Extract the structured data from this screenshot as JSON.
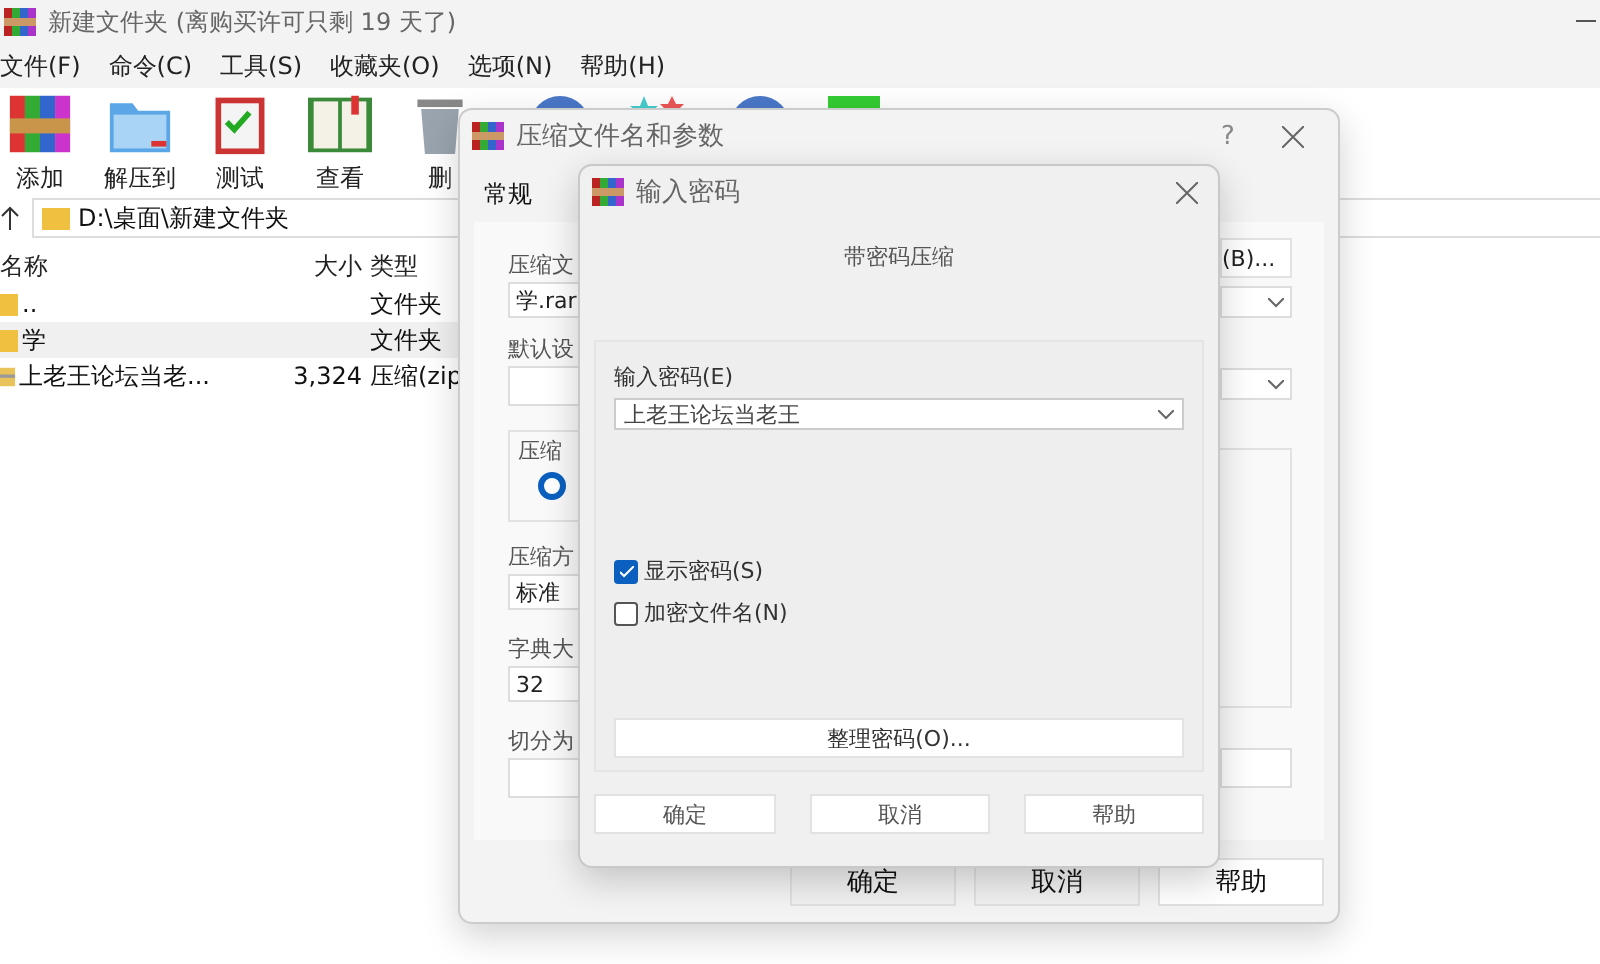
{
  "window": {
    "title": "新建文件夹 (离购买许可只剩 19 天了)"
  },
  "menu": [
    "文件(F)",
    "命令(C)",
    "工具(S)",
    "收藏夹(O)",
    "选项(N)",
    "帮助(H)"
  ],
  "toolbar": [
    {
      "kind": "add",
      "label": "添加"
    },
    {
      "kind": "extract",
      "label": "解压到"
    },
    {
      "kind": "test",
      "label": "测试"
    },
    {
      "kind": "view",
      "label": "查看"
    },
    {
      "kind": "delete",
      "label": "删"
    },
    {
      "kind": "globe"
    },
    {
      "kind": "wizard"
    },
    {
      "kind": "globe"
    },
    {
      "kind": "sfx"
    }
  ],
  "address": {
    "path": "D:\\桌面\\新建文件夹"
  },
  "file_list": {
    "columns": [
      "名称",
      "大小",
      "类型"
    ],
    "rows": [
      {
        "name": "..",
        "type": "文件夹",
        "kind": "folder",
        "selected": false
      },
      {
        "name": "学",
        "type": "文件夹",
        "kind": "folder",
        "selected": true
      },
      {
        "name": "上老王论坛当老...",
        "size": "3,324",
        "type": "压缩(zip",
        "kind": "archive",
        "selected": false
      }
    ]
  },
  "compress_dialog": {
    "title": "压缩文件名和参数",
    "help": "?",
    "tab": "常规",
    "archive_name_label": "压缩文",
    "archive_name": "学.rar",
    "browse_button": "(B)...",
    "profile_label": "默认设",
    "format_group": "压缩",
    "format_option": {
      "selected": true
    },
    "method_label": "压缩方",
    "method": "标准",
    "dict_label": "字典大",
    "dict": "32",
    "split_label": "切分为",
    "buttons": [
      "确定",
      "取消",
      "帮助"
    ]
  },
  "password_dialog": {
    "title": "输入密码",
    "heading": "带密码压缩",
    "password_label": "输入密码(E)",
    "password": "上老王论坛当老王",
    "options": [
      {
        "label": "显示密码(S)",
        "checked": true
      },
      {
        "label": "加密文件名(N)",
        "checked": false
      }
    ],
    "organize_button": "整理密码(O)...",
    "buttons": [
      "确定",
      "取消",
      "帮助"
    ]
  }
}
